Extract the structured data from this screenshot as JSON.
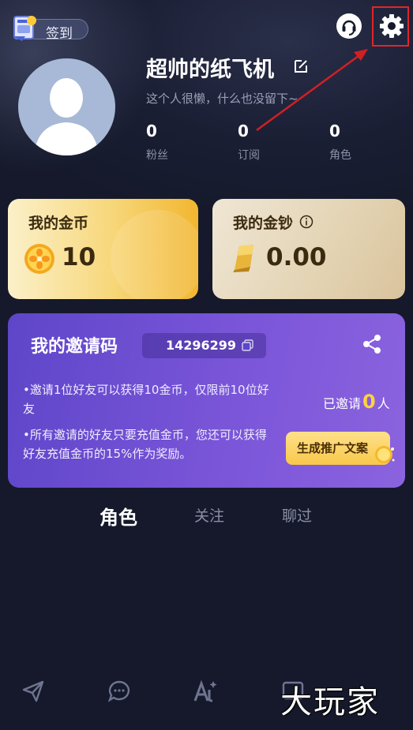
{
  "header": {
    "signin_label": "签到"
  },
  "profile": {
    "username": "超帅的纸飞机",
    "bio": "这个人很懒，什么也没留下~",
    "stats": [
      {
        "value": "0",
        "label": "粉丝"
      },
      {
        "value": "0",
        "label": "订阅"
      },
      {
        "value": "0",
        "label": "角色"
      }
    ]
  },
  "wallet": {
    "coins_title": "我的金币",
    "coins_value": "10",
    "cash_title": "我的金钞",
    "cash_value": "0.00"
  },
  "invite": {
    "title": "我的邀请码",
    "code": "14296299",
    "rules": [
      "•邀请1位好友可以获得10金币，仅限前10位好友",
      "•所有邀请的好友只要充值金币，您还可以获得好友充值金币的15%作为奖励。"
    ],
    "invited_prefix": "已邀请",
    "invited_count": "0",
    "invited_suffix": "人",
    "generate_button": "生成推广文案"
  },
  "tabs": [
    {
      "label": "角色",
      "active": true
    },
    {
      "label": "关注",
      "active": false
    },
    {
      "label": "聊过",
      "active": false
    }
  ],
  "watermark": "大玩家",
  "colors": {
    "background": "#15192b",
    "accent_purple": "#6b4fd2",
    "gold": "#f7d77a",
    "highlight": "#e0262a"
  },
  "icons": [
    "signin-book-icon",
    "support-icon",
    "settings-gear-icon",
    "edit-icon",
    "gold-coin-icon",
    "gold-bar-icon",
    "info-icon",
    "copy-icon",
    "share-icon",
    "send-icon",
    "chat-icon",
    "ai-create-icon",
    "message-icon"
  ]
}
